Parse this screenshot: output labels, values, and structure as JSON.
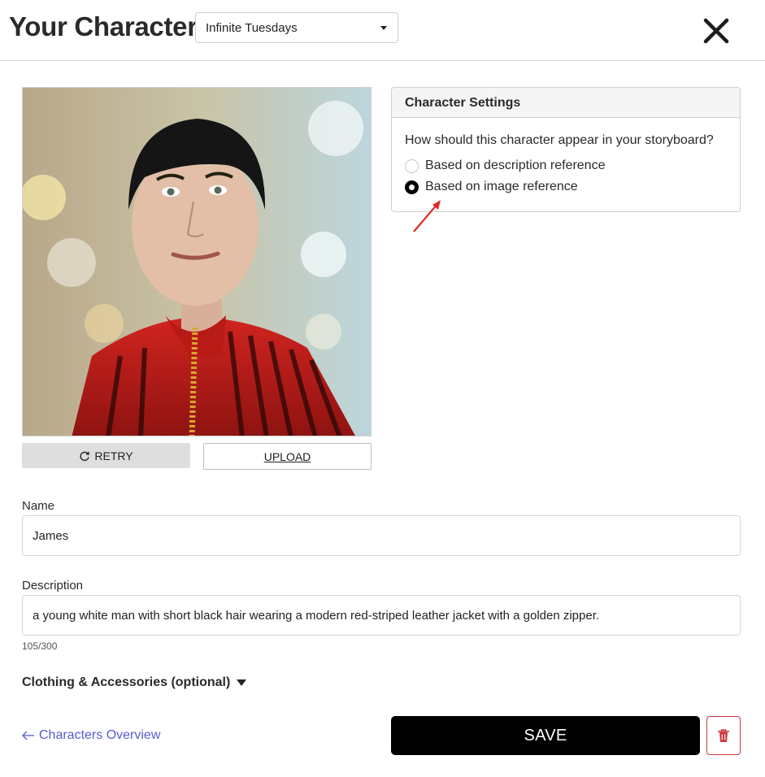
{
  "header": {
    "title": "Your Character",
    "story_select": {
      "value": "Infinite Tuesdays"
    },
    "close_icon": "close-x-icon"
  },
  "image_panel": {
    "retry_label": "RETRY",
    "retry_icon": "refresh-icon",
    "upload_label": "UPLOAD"
  },
  "settings": {
    "title": "Character Settings",
    "question": "How should this character appear in your storyboard?",
    "options": [
      {
        "label": "Based on description reference",
        "selected": false
      },
      {
        "label": "Based on image reference",
        "selected": true
      }
    ],
    "accent_color": "#e0292b"
  },
  "form": {
    "name_label": "Name",
    "name_value": "James",
    "description_label": "Description",
    "description_value": "a young white man with short black hair wearing a modern red-striped leather jacket with a golden zipper.",
    "description_counter": "105/300",
    "clothing_label": "Clothing & Accessories (optional)"
  },
  "footer": {
    "back_label": "Characters Overview",
    "back_icon": "arrow-left-icon",
    "save_label": "SAVE",
    "delete_icon": "trash-icon",
    "link_color": "#5a5ad0",
    "danger_color": "#c8393f"
  }
}
